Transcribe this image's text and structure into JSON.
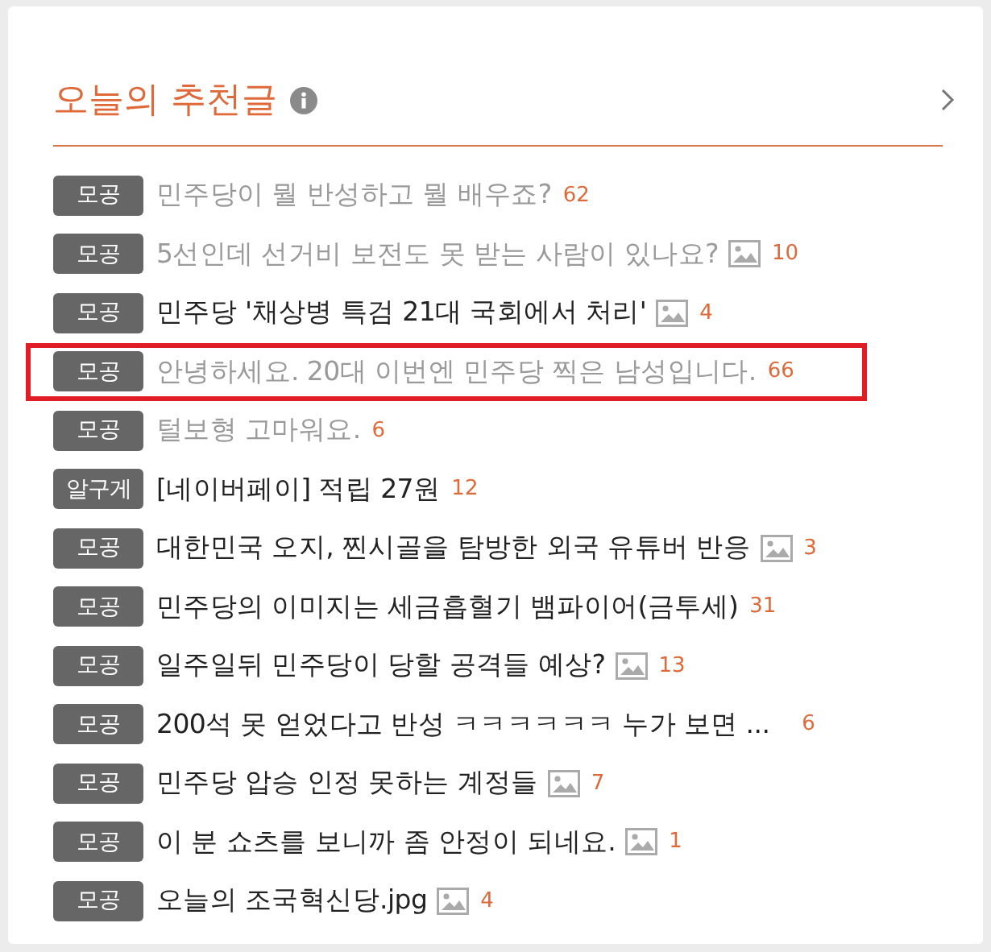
{
  "panel": {
    "title": "오늘의 추천글"
  },
  "posts": [
    {
      "tag": "모공",
      "title": "민주당이 뭘 반성하고 뭘 배우죠?",
      "comments": "62",
      "visited": true,
      "has_image": false,
      "highlighted": false
    },
    {
      "tag": "모공",
      "title": "5선인데 선거비 보전도 못 받는 사람이 있나요?",
      "comments": "10",
      "visited": true,
      "has_image": true,
      "highlighted": false
    },
    {
      "tag": "모공",
      "title": "민주당 '채상병 특검 21대 국회에서 처리'",
      "comments": "4",
      "visited": false,
      "has_image": true,
      "highlighted": false
    },
    {
      "tag": "모공",
      "title": "안녕하세요. 20대 이번엔 민주당 찍은 남성입니다.",
      "comments": "66",
      "visited": true,
      "has_image": false,
      "highlighted": true
    },
    {
      "tag": "모공",
      "title": "털보형 고마워요.",
      "comments": "6",
      "visited": true,
      "has_image": false,
      "highlighted": false
    },
    {
      "tag": "알구게",
      "title": "[네이버페이] 적립 27원",
      "comments": "12",
      "visited": false,
      "has_image": false,
      "highlighted": false
    },
    {
      "tag": "모공",
      "title": "대한민국 오지, 찐시골을 탐방한 외국 유튜버 반응",
      "comments": "3",
      "visited": false,
      "has_image": true,
      "highlighted": false
    },
    {
      "tag": "모공",
      "title": "민주당의 이미지는 세금흡혈기 뱀파이어(금투세)",
      "comments": "31",
      "visited": false,
      "has_image": false,
      "highlighted": false
    },
    {
      "tag": "모공",
      "title": "일주일뒤 민주당이 당할 공격들 예상?",
      "comments": "13",
      "visited": false,
      "has_image": true,
      "highlighted": false
    },
    {
      "tag": "모공",
      "title": "200석 못 얻었다고 반성 ㅋㅋㅋㅋㅋㅋ 누가 보면 ...",
      "comments": "6",
      "visited": false,
      "has_image": false,
      "highlighted": false
    },
    {
      "tag": "모공",
      "title": "민주당 압승 인정 못하는 계정들",
      "comments": "7",
      "visited": false,
      "has_image": true,
      "highlighted": false
    },
    {
      "tag": "모공",
      "title": "이 분 쇼츠를 보니까 좀 안정이 되네요.",
      "comments": "1",
      "visited": false,
      "has_image": true,
      "highlighted": false
    },
    {
      "tag": "모공",
      "title": "오늘의 조국혁신당.jpg",
      "comments": "4",
      "visited": false,
      "has_image": true,
      "highlighted": false
    }
  ]
}
